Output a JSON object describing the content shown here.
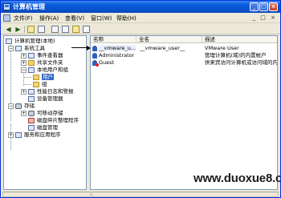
{
  "window": {
    "title": "计算机管理"
  },
  "menubar": {
    "items": [
      {
        "label": "文件(F)"
      },
      {
        "label": "操作(A)"
      },
      {
        "label": "查看(V)"
      },
      {
        "label": "窗口(W)"
      },
      {
        "label": "帮助(H)"
      }
    ]
  },
  "tree": {
    "root": "计算机管理(本地)",
    "system_tools": "系统工具",
    "event_viewer": "事件查看器",
    "shared_folders": "共享文件夹",
    "local_users_groups": "本地用户和组",
    "users": "用户",
    "groups": "组",
    "perf_logs": "性能日志和警报",
    "device_manager": "设备管理器",
    "storage": "存储",
    "removable_storage": "可移动存储",
    "defrag": "磁盘碎片整理程序",
    "disk_management": "磁盘管理",
    "services_apps": "服务和应用程序"
  },
  "list": {
    "columns": [
      "名称",
      "全名",
      "描述"
    ],
    "rows": [
      {
        "name": "__vmware_u...",
        "full_name": "__vmware_user__",
        "description": "VMware User"
      },
      {
        "name": "Administrator",
        "full_name": "",
        "description": "管理计算机(域)的内置帐户"
      },
      {
        "name": "Guest",
        "full_name": "",
        "description": "供来宾访问计算机或访问域的内"
      }
    ]
  },
  "watermark": "www.duoxue8.com",
  "icons": [
    "back-icon",
    "forward-icon",
    "up-icon",
    "properties-icon",
    "refresh-icon",
    "export-icon",
    "help-icon",
    "console-icon"
  ],
  "colors": {
    "title_bar": "#0a5bdc",
    "selection": "#316ac5"
  }
}
